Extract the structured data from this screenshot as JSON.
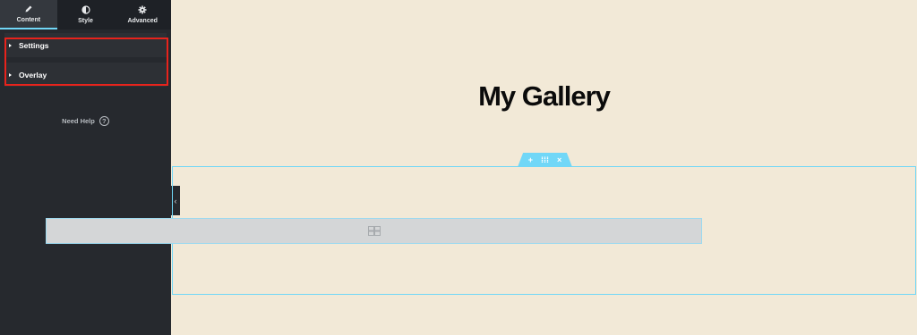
{
  "sidebar": {
    "tabs": [
      {
        "label": "Content",
        "icon": "pencil-icon",
        "active": true
      },
      {
        "label": "Style",
        "icon": "half-circle-icon",
        "active": false
      },
      {
        "label": "Advanced",
        "icon": "gear-icon",
        "active": false
      }
    ],
    "sections": [
      {
        "label": "Settings"
      },
      {
        "label": "Overlay"
      }
    ],
    "help": {
      "label": "Need Help",
      "icon": "question-icon"
    }
  },
  "canvas": {
    "title": "My Gallery",
    "handle_icons": [
      "plus-icon",
      "drag-handle-icon",
      "close-icon"
    ],
    "widget_icon": "gallery-icon"
  },
  "colors": {
    "accent": "#71d7f7",
    "highlight": "#e8231c",
    "sidebar_bg": "#26292e",
    "canvas_bg": "#f2e9d7"
  }
}
